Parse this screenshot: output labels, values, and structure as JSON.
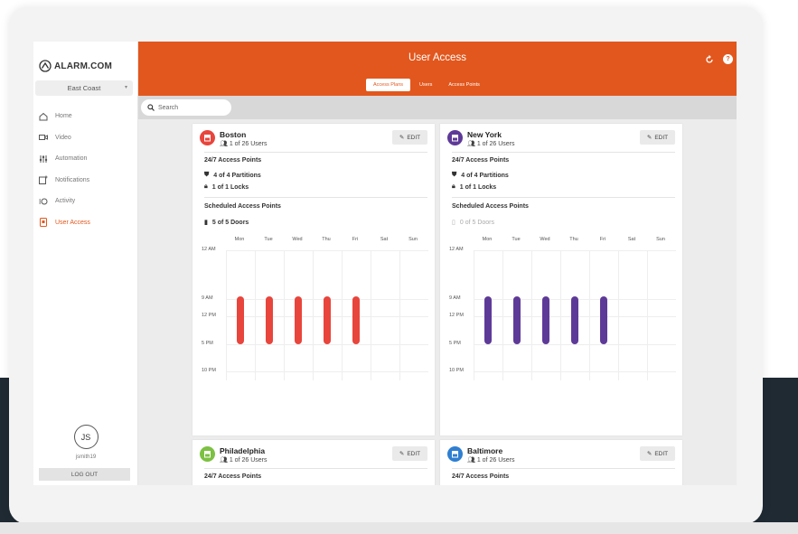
{
  "app": {
    "logo_text": "ALARM.COM",
    "location": "East Coast",
    "title": "User Access",
    "accent": "#e2571d"
  },
  "tabs": [
    {
      "label": "Access Plans",
      "active": true
    },
    {
      "label": "Users",
      "active": false
    },
    {
      "label": "Access Points",
      "active": false
    }
  ],
  "nav": [
    {
      "label": "Home",
      "icon": "home-icon"
    },
    {
      "label": "Video",
      "icon": "video-camera-icon"
    },
    {
      "label": "Automation",
      "icon": "automation-icon"
    },
    {
      "label": "Notifications",
      "icon": "notifications-icon"
    },
    {
      "label": "Activity",
      "icon": "activity-icon"
    },
    {
      "label": "User Access",
      "icon": "user-access-icon",
      "active": true
    }
  ],
  "user": {
    "initials": "JS",
    "username": "jsmith19",
    "logout_label": "LOG OUT"
  },
  "search": {
    "placeholder": "Search"
  },
  "edit_label": "EDIT",
  "days": [
    "Mon",
    "Tue",
    "Wed",
    "Thu",
    "Fri",
    "Sat",
    "Sun"
  ],
  "time_labels": [
    "12 AM",
    "9 AM",
    "12 PM",
    "5 PM",
    "10 PM"
  ],
  "labels": {
    "always": "24/7 Access Points",
    "scheduled": "Scheduled Access Points"
  },
  "sites": [
    {
      "name": "Boston",
      "users": "1 of 26 Users",
      "color": "#e8453c",
      "partitions": "4 of 4 Partitions",
      "locks": "1 of 1 Locks",
      "doors": "5 of 5 Doors",
      "doors_muted": false,
      "schedule": {
        "days": [
          "Mon",
          "Tue",
          "Wed",
          "Thu",
          "Fri"
        ],
        "start": "9 AM",
        "end": "5 PM"
      }
    },
    {
      "name": "New York",
      "users": "1 of 26 Users",
      "color": "#5e3a98",
      "partitions": "4 of 4 Partitions",
      "locks": "1 of 1 Locks",
      "doors": "0 of 5 Doors",
      "doors_muted": true,
      "schedule": {
        "days": [
          "Mon",
          "Tue",
          "Wed",
          "Thu",
          "Fri"
        ],
        "start": "9 AM",
        "end": "5 PM"
      }
    },
    {
      "name": "Philadelphia",
      "users": "1 of 26 Users",
      "color": "#7cc142"
    },
    {
      "name": "Baltimore",
      "users": "1 of 26 Users",
      "color": "#2f7fd1"
    }
  ]
}
